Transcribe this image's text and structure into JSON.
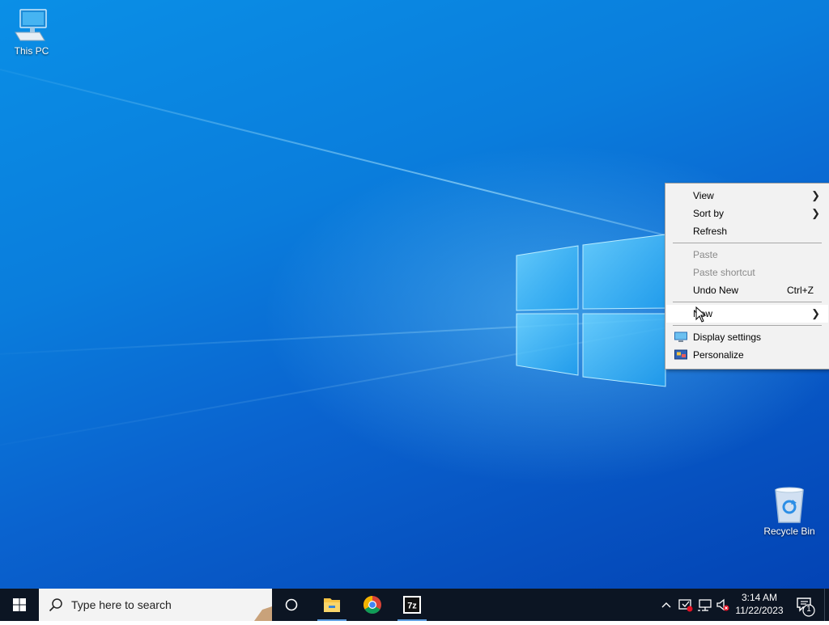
{
  "desktop": {
    "icons": [
      {
        "label": "This PC",
        "icon": "computer-icon"
      },
      {
        "label": "Recycle Bin",
        "icon": "recycle-bin-icon"
      }
    ]
  },
  "context_menu": {
    "items": [
      {
        "label": "View",
        "submenu": true,
        "enabled": true
      },
      {
        "label": "Sort by",
        "submenu": true,
        "enabled": true
      },
      {
        "label": "Refresh",
        "enabled": true
      },
      {
        "label": "Paste",
        "enabled": false
      },
      {
        "label": "Paste shortcut",
        "enabled": false
      },
      {
        "label": "Undo New",
        "shortcut": "Ctrl+Z",
        "enabled": true
      },
      {
        "label": "New",
        "submenu": true,
        "enabled": true,
        "highlighted": true
      },
      {
        "label": "Display settings",
        "icon": "display-icon",
        "enabled": true
      },
      {
        "label": "Personalize",
        "icon": "personalize-icon",
        "enabled": true
      }
    ]
  },
  "taskbar": {
    "search_placeholder": "Type here to search",
    "pinned": [
      "task-view",
      "file-explorer",
      "chrome",
      "7-zip"
    ],
    "clock": {
      "time": "3:14 AM",
      "date": "11/22/2023"
    },
    "notifications_count": "1"
  },
  "colors": {
    "taskbar": "#0c1523",
    "menu_bg": "#f2f2f2",
    "disabled_text": "#8a8a8a",
    "accent": "#0078d7"
  }
}
